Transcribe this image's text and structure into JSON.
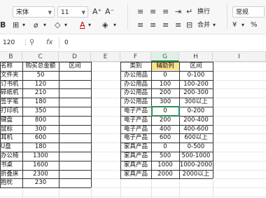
{
  "ribbon": {
    "font_name": "宋体",
    "font_size": "11",
    "wrap_label": "换行",
    "merge_label": "合并",
    "number_format": "常规",
    "bold": "B",
    "font_color_letter": "A",
    "grow_font": "A⁺",
    "shrink_font": "A⁻"
  },
  "formula_bar": {
    "cell_ref": "120",
    "fx": "fx",
    "content": "0"
  },
  "columns": [
    "B",
    "C",
    "D",
    "E",
    "F",
    "G",
    "H",
    "I"
  ],
  "table1": {
    "headers": [
      "名称",
      "购买总金额",
      "区间"
    ],
    "rows": [
      [
        "文件夹",
        "50"
      ],
      [
        "订书机",
        "120"
      ],
      [
        "碎纸机",
        "210"
      ],
      [
        "签字笔",
        "180"
      ],
      [
        "打印机",
        "350"
      ],
      [
        "键盘",
        "800"
      ],
      [
        "鼠标",
        "300"
      ],
      [
        "耳机",
        "600"
      ],
      [
        "U盘",
        "180"
      ],
      [
        "办公椅",
        "1300"
      ],
      [
        "书桌",
        "1600"
      ],
      [
        "折叠床",
        "2300"
      ],
      [
        "抱枕",
        "230"
      ]
    ]
  },
  "table2": {
    "headers": [
      "类别",
      "辅助列",
      "区间"
    ],
    "rows": [
      [
        "办公用品",
        "0",
        "0-100"
      ],
      [
        "办公用品",
        "100",
        "100-200"
      ],
      [
        "办公用品",
        "200",
        "200-300"
      ],
      [
        "办公用品",
        "300",
        "300以上"
      ],
      [
        "电子产品",
        "0",
        "0-200"
      ],
      [
        "电子产品",
        "200",
        "200-400"
      ],
      [
        "电子产品",
        "400",
        "400-600"
      ],
      [
        "电子产品",
        "600",
        "600以上"
      ],
      [
        "家具产品",
        "0",
        "0-500"
      ],
      [
        "家具产品",
        "500",
        "500-1000"
      ],
      [
        "家具产品",
        "1000",
        "1000-2000"
      ],
      [
        "家具产品",
        "2000",
        "2000以上"
      ]
    ]
  },
  "colors": {
    "helper_header_fill": "#fde38b",
    "selection": "#2e8b57"
  }
}
